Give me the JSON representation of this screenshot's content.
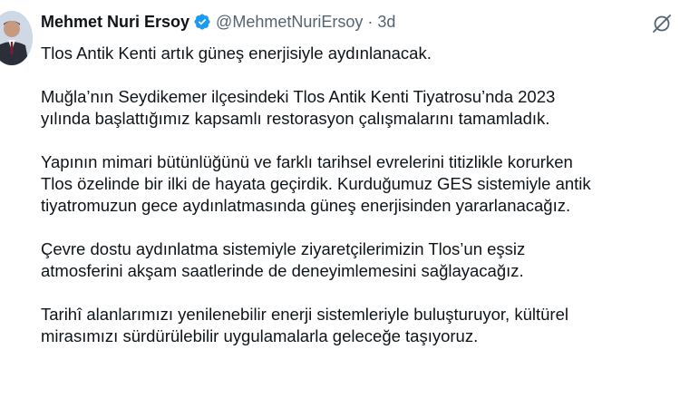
{
  "author": {
    "display_name": "Mehmet Nuri Ersoy",
    "handle": "@MehmetNuriErsoy",
    "separator": "·",
    "time": "3d"
  },
  "icons": {
    "verified": "verified-badge-icon",
    "grok": "grok-icon",
    "accent_color": "#1d9bf0"
  },
  "tweet": {
    "paragraphs": [
      {
        "lines": [
          "Tlos Antik Kenti artık güneş enerjisiyle aydınlanacak."
        ]
      },
      {
        "lines": [
          "Muğla’nın Seydikemer ilçesindeki Tlos Antik Kenti Tiyatrosu’nda 2023",
          "yılında başlattığımız kapsamlı restorasyon çalışmalarını tamamladık."
        ]
      },
      {
        "lines": [
          "Yapının mimari bütünlüğünü ve farklı tarihsel evrelerini titizlikle korurken",
          "Tlos özelinde bir ilki de hayata geçirdik. Kurduğumuz GES sistemiyle antik",
          "tiyatromuzun gece aydınlatmasında güneş enerjisinden yararlanacağız."
        ]
      },
      {
        "lines": [
          "Çevre dostu aydınlatma sistemiyle ziyaretçilerimizin Tlos’un eşsiz",
          "atmosferini akşam saatlerinde de deneyimlemesini sağlayacağız."
        ]
      },
      {
        "lines": [
          "Tarihî alanlarımızı yenilenebilir enerji sistemleriyle buluşturuyor, kültürel",
          "mirasımızı sürdürülebilir uygulamalarla geleceğe taşıyoruz."
        ]
      }
    ]
  }
}
